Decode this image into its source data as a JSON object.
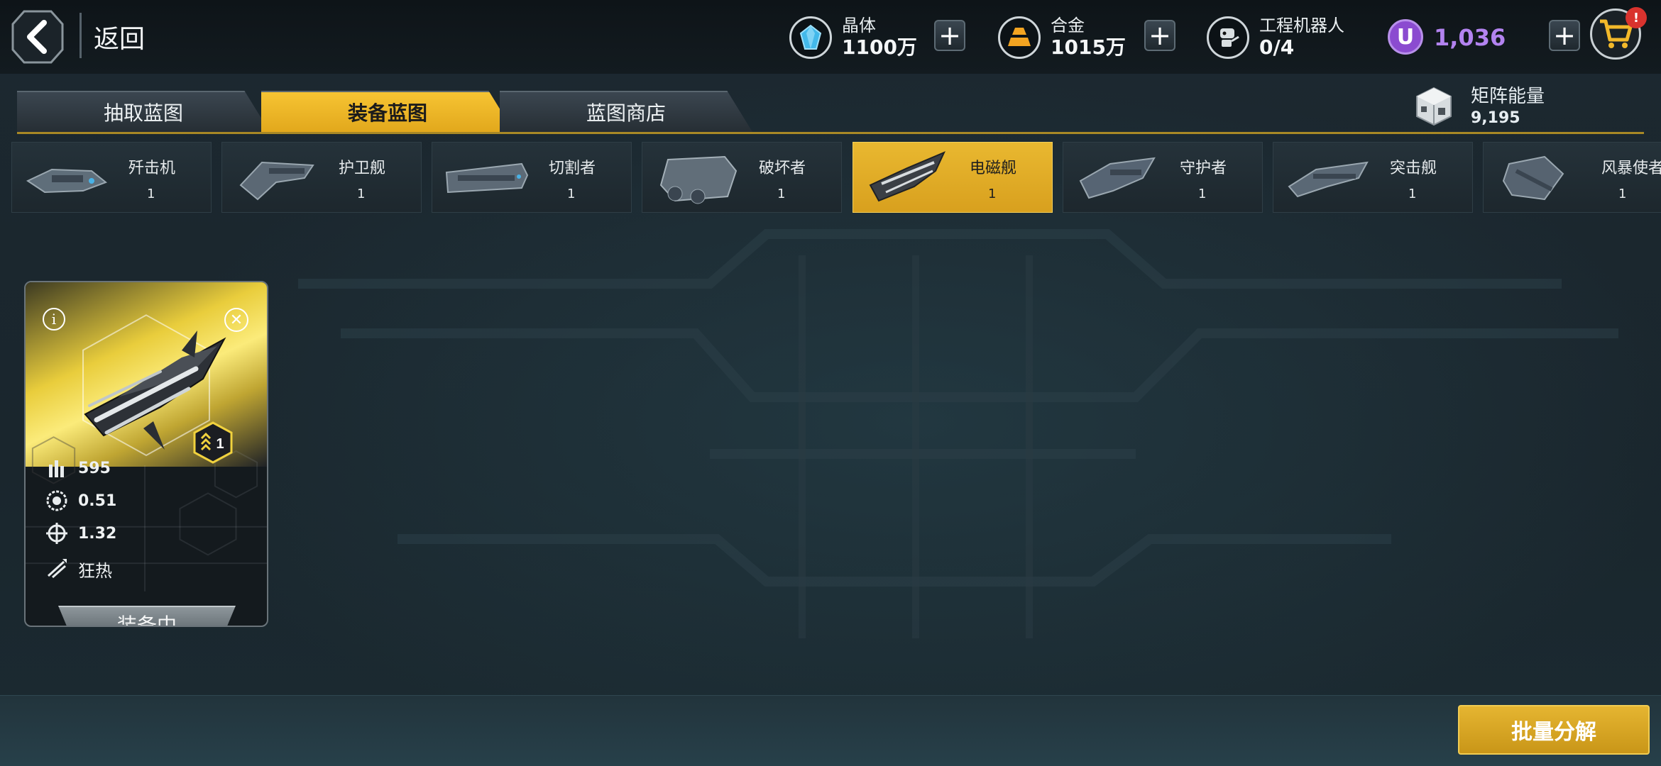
{
  "topbar": {
    "back_label": "返回",
    "resources": [
      {
        "name": "晶体",
        "value": "1100万",
        "icon": "crystal-icon",
        "color": "#38b7e8"
      },
      {
        "name": "合金",
        "value": "1015万",
        "icon": "alloy-icon",
        "color": "#f0a21f"
      },
      {
        "name": "工程机器人",
        "value": "0/4",
        "icon": "robot-icon"
      }
    ],
    "premium": {
      "symbol": "U",
      "value": "1,036",
      "color": "#b383f0"
    },
    "cart_badge": "!"
  },
  "tabs": [
    {
      "label": "抽取蓝图",
      "active": false
    },
    {
      "label": "装备蓝图",
      "active": true
    },
    {
      "label": "蓝图商店",
      "active": false
    }
  ],
  "matrix_energy": {
    "name": "矩阵能量",
    "value": "9,195"
  },
  "ship_types": [
    {
      "label": "歼击机",
      "count": "1",
      "active": false
    },
    {
      "label": "护卫舰",
      "count": "1",
      "active": false
    },
    {
      "label": "切割者",
      "count": "1",
      "active": false
    },
    {
      "label": "破坏者",
      "count": "1",
      "active": false
    },
    {
      "label": "电磁舰",
      "count": "1",
      "active": true
    },
    {
      "label": "守护者",
      "count": "1",
      "active": false
    },
    {
      "label": "突击舰",
      "count": "1",
      "active": false
    },
    {
      "label": "风暴使者",
      "count": "1",
      "active": false
    }
  ],
  "blueprint_card": {
    "rank": "1",
    "stats": [
      {
        "icon": "ammo-icon",
        "value": "595"
      },
      {
        "icon": "rate-icon",
        "value": "0.51"
      },
      {
        "icon": "crosshair-icon",
        "value": "1.32"
      },
      {
        "icon": "trait-icon",
        "value": "狂热"
      }
    ],
    "status_label": "装备中"
  },
  "batch_button_label": "批量分解",
  "colors": {
    "accent": "#e9b830",
    "bg": "#1a252c"
  }
}
